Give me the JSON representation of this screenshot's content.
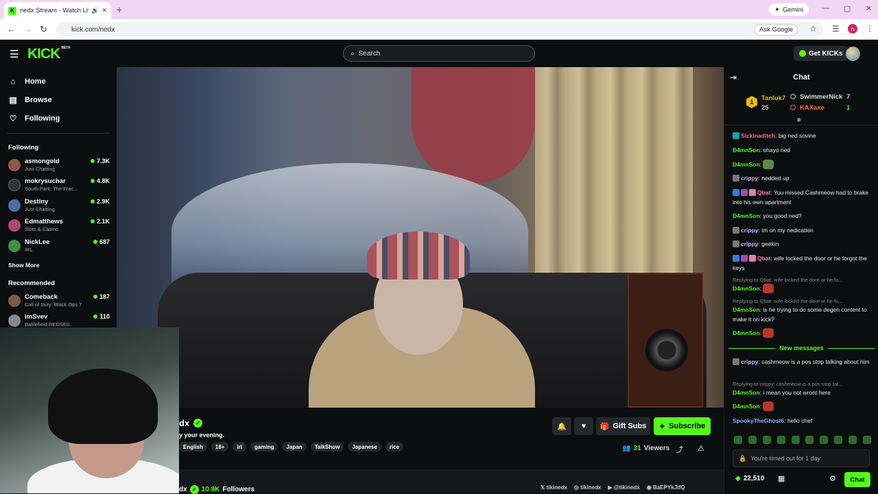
{
  "browser": {
    "tab_title": "nedx Stream - Watch Live o",
    "new_tab": "+",
    "gemini_label": "Gemini",
    "url": "kick.com/nedx",
    "ask_google": "Ask Google",
    "profile_initial": "n"
  },
  "header": {
    "logo": "KICK",
    "logo_sup": "BETA",
    "search_placeholder": "Search",
    "get_kicks": "Get KICKs"
  },
  "sidebar": {
    "nav": [
      {
        "label": "Home"
      },
      {
        "label": "Browse"
      },
      {
        "label": "Following"
      }
    ],
    "following_title": "Following",
    "following": [
      {
        "name": "asmongold",
        "category": "Just Chatting",
        "viewers": "7.3K",
        "color": "#8a5a4a"
      },
      {
        "name": "mokrysuchar",
        "category": "South Park: The Frac...",
        "viewers": "4.8K",
        "color": "#333333"
      },
      {
        "name": "Destiny",
        "category": "Just Chatting",
        "viewers": "2.9K",
        "color": "#4a6fa5"
      },
      {
        "name": "Edmatthews",
        "category": "Slots & Casino",
        "viewers": "2.1K",
        "color": "#b0466e"
      },
      {
        "name": "NickLee",
        "category": "IRL",
        "viewers": "687",
        "color": "#3e8e41"
      }
    ],
    "show_more": "Show More",
    "recommended_title": "Recommended",
    "recommended": [
      {
        "name": "Comeback",
        "category": "Call of Duty: Black Ops 7",
        "viewers": "187",
        "color": "#7a5c44"
      },
      {
        "name": "imSvev",
        "category": "Battlefield REDSEC",
        "viewers": "110",
        "color": "#888888"
      }
    ]
  },
  "stream": {
    "name": "dx",
    "title": "y your evening.",
    "tags": [
      "English",
      "18+",
      "irl",
      "gaming",
      "Japan",
      "TalkShow",
      "Japanese",
      "rice"
    ],
    "gift_subs": "Gift Subs",
    "subscribe": "Subscribe",
    "viewers_count": "31",
    "viewers_label": "Viewers",
    "about_name": "dx",
    "followers_count": "10.9K",
    "followers_label": "Followers",
    "socials": [
      "tikinedx",
      "tikinedx",
      "@tikinedx",
      "BaEPYkJtfQ"
    ]
  },
  "chat": {
    "title": "Chat",
    "leaderboard": {
      "rank": "1",
      "first_name": "Tanluk7",
      "first_count": "25",
      "second_name": "SwimmerNick",
      "second_count": "7",
      "third_name": "KAXaxe",
      "third_count": "1"
    },
    "messages": [
      {
        "user": "Sickinaditch",
        "text": "big ned sovine",
        "color": "#ff6b8a"
      },
      {
        "user": "D4mnSon",
        "text": "ohayo ned",
        "color": "#53fc18"
      },
      {
        "user": "D4mnSon",
        "text": "",
        "color": "#53fc18"
      },
      {
        "user": "crippy",
        "text": "nedded up",
        "color": "#c9b3ff"
      },
      {
        "user": "Qbat",
        "text": "You missed Cashmeow had to brake into his own apartment",
        "color": "#ff7ad0"
      },
      {
        "user": "D4mnSon",
        "text": "you good ned?",
        "color": "#53fc18"
      },
      {
        "user": "crippy",
        "text": "im on my nedication",
        "color": "#c9b3ff"
      },
      {
        "user": "crippy",
        "text": "geekin",
        "color": "#c9b3ff"
      },
      {
        "user": "Qbat",
        "text": "wife locked the door or he forgot the keys",
        "color": "#ff7ad0"
      },
      {
        "user": "D4mnSon",
        "text": "",
        "color": "#53fc18"
      },
      {
        "user": "D4mnSon",
        "text": "is he trying to do some degen content to make it on kick?",
        "color": "#53fc18"
      },
      {
        "user": "D4mnSon",
        "text": "",
        "color": "#53fc18"
      },
      {
        "user": "crippy",
        "text": "cashmeow is a pos stop talking about him",
        "color": "#c9b3ff"
      },
      {
        "user": "D4mnSon",
        "text": "i mean you not wront here",
        "color": "#53fc18"
      },
      {
        "user": "D4mnSon",
        "text": "",
        "color": "#53fc18"
      },
      {
        "user": "SpookyTheGhost6",
        "text": "hello chef",
        "color": "#8ab4ff"
      }
    ],
    "replies": [
      "Replying to Qbat: wife locked the door or he fo...",
      "Replying to Qbat: wife locked the door or he fo...",
      "Replying to crippy: cashmeow is a pos stop tal..."
    ],
    "new_messages": "New messages",
    "input_placeholder": "You're timed out for 1 day",
    "points": "22,510",
    "send_label": "Chat"
  }
}
